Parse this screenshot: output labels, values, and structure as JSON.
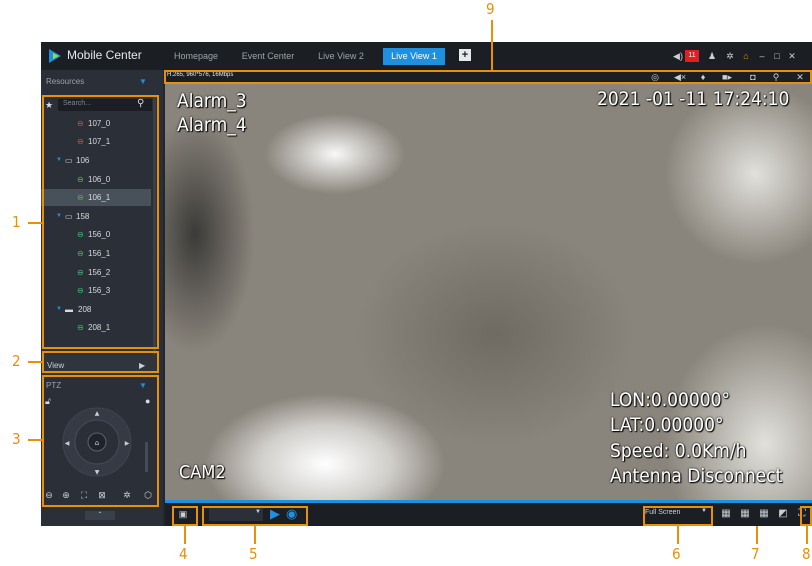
{
  "app": {
    "title": "Mobile Center"
  },
  "tabs": [
    {
      "label": "Homepage",
      "active": false
    },
    {
      "label": "Event Center",
      "active": false
    },
    {
      "label": "Live View 2",
      "active": false
    },
    {
      "label": "Live View 1",
      "active": true
    }
  ],
  "header": {
    "alarm_count": "11"
  },
  "sidebar": {
    "resources_label": "Resources",
    "search_placeholder": "Search...",
    "tree": [
      {
        "label": "107_0",
        "type": "camera",
        "status": "offline"
      },
      {
        "label": "107_1",
        "type": "camera",
        "status": "offline"
      },
      {
        "label": "106",
        "type": "device"
      },
      {
        "label": "106_0",
        "type": "camera",
        "status": "online"
      },
      {
        "label": "106_1",
        "type": "camera",
        "status": "online",
        "selected": true
      },
      {
        "label": "158",
        "type": "device"
      },
      {
        "label": "156_0",
        "type": "camera",
        "status": "online"
      },
      {
        "label": "156_1",
        "type": "camera",
        "status": "online"
      },
      {
        "label": "156_2",
        "type": "camera",
        "status": "online"
      },
      {
        "label": "156_3",
        "type": "camera",
        "status": "online"
      },
      {
        "label": "208",
        "type": "device"
      },
      {
        "label": "208_1",
        "type": "camera",
        "status": "online"
      }
    ],
    "view_label": "View",
    "ptz_label": "PTZ"
  },
  "video": {
    "stream_info": "H.265, 960*576, 16Mbps",
    "osd_alarm_1": "Alarm_3",
    "osd_alarm_2": "Alarm_4",
    "osd_datetime": "2021 -01 -11  17:24:10",
    "osd_camera": "CAM2",
    "osd_lon": "LON:0.00000°",
    "osd_lat": "LAT:0.00000°",
    "osd_speed": "Speed: 0.0Km/h",
    "osd_antenna": "Antenna Disconnect"
  },
  "bottom_bar": {
    "fullscreen_label": "Full Screen"
  },
  "callouts": [
    "1",
    "2",
    "3",
    "4",
    "5",
    "6",
    "7",
    "8",
    "9"
  ],
  "colors": {
    "accent": "#1f8fe0",
    "callout": "#e8900a",
    "online": "#3fbf6b",
    "offline": "#e0494a"
  }
}
